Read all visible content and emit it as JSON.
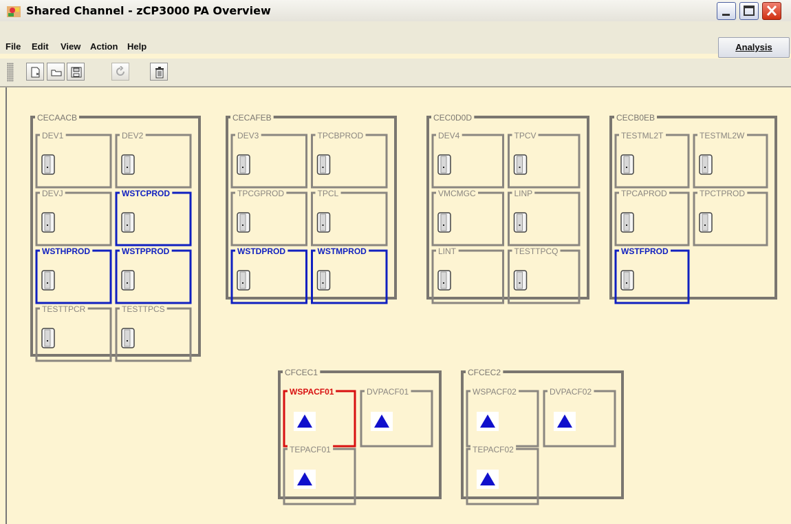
{
  "window": {
    "title": "Shared Channel - zCP3000 PA Overview"
  },
  "menus": [
    "File",
    "Edit",
    "View",
    "Action",
    "Help"
  ],
  "analysis_label": "Analysis",
  "toolbar": [
    "new-document-icon",
    "open-folder-icon",
    "save-disk-icon",
    "refresh-icon",
    "trash-icon"
  ],
  "colors": {
    "background": "#fdf4d2",
    "frame_default": "#7a7670",
    "frame_selected_blue": "#1020c0",
    "frame_alert_red": "#d81010",
    "label_default": "#8a8680",
    "triangle": "#1010cc"
  },
  "groups": [
    {
      "name": "CECAACB",
      "systems": [
        {
          "label": "DEV1",
          "state": "normal"
        },
        {
          "label": "DEV2",
          "state": "normal"
        },
        {
          "label": "DEVJ",
          "state": "normal"
        },
        {
          "label": "WSTCPROD",
          "state": "selected"
        },
        {
          "label": "WSTHPROD",
          "state": "selected"
        },
        {
          "label": "WSTPPROD",
          "state": "selected"
        },
        {
          "label": "TESTTPCR",
          "state": "normal"
        },
        {
          "label": "TESTTPCS",
          "state": "normal"
        }
      ]
    },
    {
      "name": "CECAFEB",
      "systems": [
        {
          "label": "DEV3",
          "state": "normal"
        },
        {
          "label": "TPCBPROD",
          "state": "normal"
        },
        {
          "label": "TPCGPROD",
          "state": "normal"
        },
        {
          "label": "TPCL",
          "state": "normal"
        },
        {
          "label": "WSTDPROD",
          "state": "selected"
        },
        {
          "label": "WSTMPROD",
          "state": "selected"
        }
      ]
    },
    {
      "name": "CEC0D0D",
      "systems": [
        {
          "label": "DEV4",
          "state": "normal"
        },
        {
          "label": "TPCV",
          "state": "normal"
        },
        {
          "label": "VMCMGC",
          "state": "normal"
        },
        {
          "label": "LINP",
          "state": "normal"
        },
        {
          "label": "LINT",
          "state": "normal"
        },
        {
          "label": "TESTTPCQ",
          "state": "normal"
        }
      ]
    },
    {
      "name": "CECB0EB",
      "systems": [
        {
          "label": "TESTML2T",
          "state": "normal"
        },
        {
          "label": "TESTML2W",
          "state": "normal"
        },
        {
          "label": "TPCAPROD",
          "state": "normal"
        },
        {
          "label": "TPCTPROD",
          "state": "normal"
        },
        {
          "label": "WSTFPROD",
          "state": "selected"
        }
      ]
    }
  ],
  "cf_groups": [
    {
      "name": "CFCEC1",
      "systems": [
        {
          "label": "WSPACF01",
          "state": "alert"
        },
        {
          "label": "DVPACF01",
          "state": "normal"
        },
        {
          "label": "TEPACF01",
          "state": "normal"
        }
      ]
    },
    {
      "name": "CFCEC2",
      "systems": [
        {
          "label": "WSPACF02",
          "state": "normal"
        },
        {
          "label": "DVPACF02",
          "state": "normal"
        },
        {
          "label": "TEPACF02",
          "state": "normal"
        }
      ]
    }
  ]
}
